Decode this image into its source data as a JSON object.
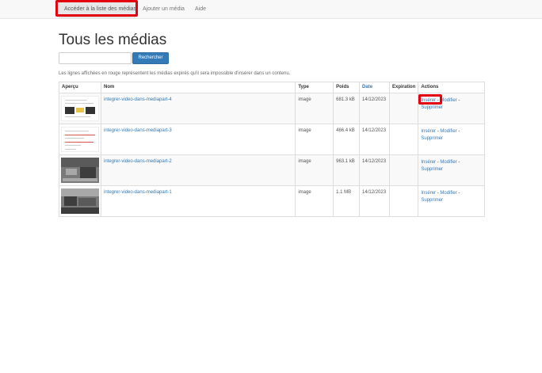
{
  "nav": {
    "items": [
      {
        "label": "Accéder à la liste des médias",
        "active": true
      },
      {
        "label": "Ajouter un média"
      },
      {
        "label": "Aide"
      }
    ]
  },
  "page": {
    "title": "Tous les médias",
    "search_placeholder": "",
    "search_button": "Rechercher",
    "info_text": "Les lignes affichées en rouge représentent les médias expirés qu'il sera impossible d'insérer dans un contenu."
  },
  "table": {
    "headers": {
      "apercu": "Aperçu",
      "nom": "Nom",
      "type": "Type",
      "poids": "Poids",
      "date": "Date",
      "expiration": "Expiration",
      "actions": "Actions"
    },
    "rows": [
      {
        "nom": "integrer-video-dans-mediapart-4",
        "type": "image",
        "poids": "681.3 kB",
        "date": "14/12/2023",
        "expiration": "",
        "thumb": "document"
      },
      {
        "nom": "integrer-video-dans-mediapart-3",
        "type": "image",
        "poids": "466.4 kB",
        "date": "14/12/2023",
        "expiration": "",
        "thumb": "document"
      },
      {
        "nom": "integrer-video-dans-mediapart-2",
        "type": "image",
        "poids": "963.1 kB",
        "date": "14/12/2023",
        "expiration": "",
        "thumb": "photo"
      },
      {
        "nom": "integrer-video-dans-mediapart-1",
        "type": "image",
        "poids": "1.1 MB",
        "date": "14/12/2023",
        "expiration": "",
        "thumb": "photo"
      }
    ],
    "actions": {
      "insert": "Insérer",
      "edit": "Modifier",
      "delete": "Supprimer",
      "separator": "-"
    }
  },
  "colors": {
    "link": "#337ab7",
    "highlight": "#e3000f",
    "nav_bg": "#f8f8f8"
  }
}
